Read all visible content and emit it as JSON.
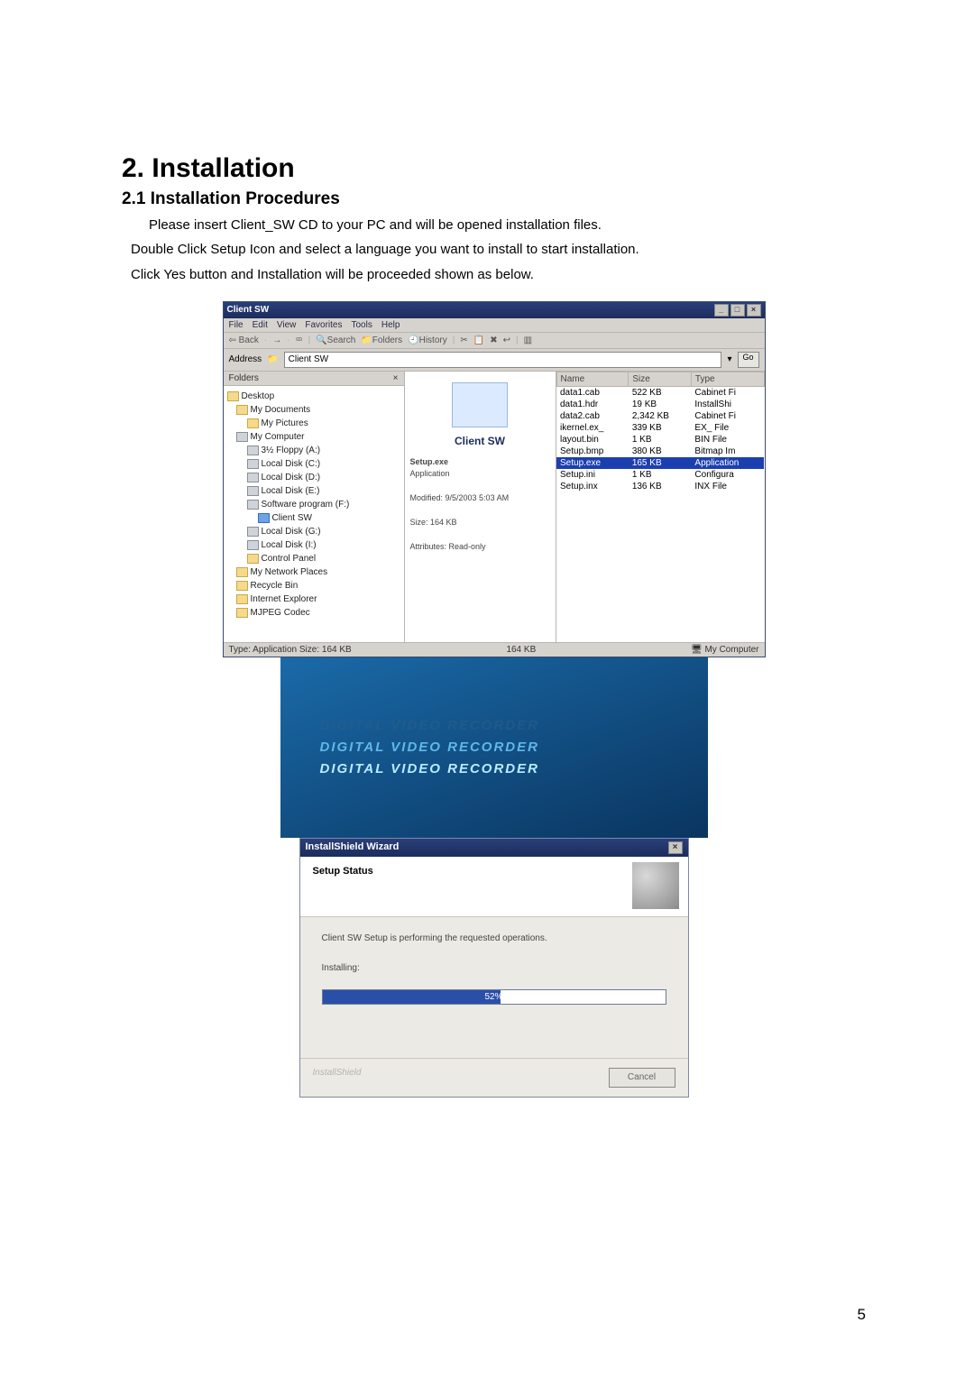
{
  "doc": {
    "h1": "2. Installation",
    "h2": "2.1 Installation Procedures",
    "p1": "Please insert Client_SW CD to your PC and will be opened installation files.",
    "p2": "Double Click Setup Icon and select a language you want to install to start installation.",
    "p3": "Click Yes button and Installation will be proceeded shown as below.",
    "page_number": "5"
  },
  "explorer": {
    "title": "Client SW",
    "menu": [
      "File",
      "Edit",
      "View",
      "Favorites",
      "Tools",
      "Help"
    ],
    "toolbar": {
      "back": "Back",
      "search": "Search",
      "folders": "Folders",
      "history": "History"
    },
    "address_label": "Address",
    "address_value": "Client SW",
    "go": "Go",
    "folders_label": "Folders",
    "close_x": "×",
    "tree": [
      {
        "lvl": 0,
        "label": "Desktop",
        "ic": "ic"
      },
      {
        "lvl": 1,
        "label": "My Documents",
        "ic": "ic"
      },
      {
        "lvl": 2,
        "label": "My Pictures",
        "ic": "ic"
      },
      {
        "lvl": 1,
        "label": "My Computer",
        "ic": "ic disk"
      },
      {
        "lvl": 2,
        "label": "3½ Floppy (A:)",
        "ic": "ic disk"
      },
      {
        "lvl": 2,
        "label": "Local Disk (C:)",
        "ic": "ic disk"
      },
      {
        "lvl": 2,
        "label": "Local Disk (D:)",
        "ic": "ic disk"
      },
      {
        "lvl": 2,
        "label": "Local Disk (E:)",
        "ic": "ic disk"
      },
      {
        "lvl": 2,
        "label": "Software program (F:)",
        "ic": "ic disk"
      },
      {
        "lvl": 3,
        "label": "Client SW",
        "ic": "ic sel"
      },
      {
        "lvl": 2,
        "label": "Local Disk (G:)",
        "ic": "ic disk"
      },
      {
        "lvl": 2,
        "label": "Local Disk (I:)",
        "ic": "ic disk"
      },
      {
        "lvl": 2,
        "label": "Control Panel",
        "ic": "ic"
      },
      {
        "lvl": 1,
        "label": "My Network Places",
        "ic": "ic"
      },
      {
        "lvl": 1,
        "label": "Recycle Bin",
        "ic": "ic"
      },
      {
        "lvl": 1,
        "label": "Internet Explorer",
        "ic": "ic"
      },
      {
        "lvl": 1,
        "label": "MJPEG Codec",
        "ic": "ic"
      }
    ],
    "preview": {
      "title": "Client SW",
      "line1": "Setup.exe",
      "line2": "Application",
      "line3": "Modified: 9/5/2003 5:03 AM",
      "line4": "Size: 164 KB",
      "line5": "Attributes: Read-only"
    },
    "columns": [
      "Name",
      "Size",
      "Type"
    ],
    "files": [
      {
        "name": "data1.cab",
        "size": "522 KB",
        "type": "Cabinet Fi",
        "sel": false
      },
      {
        "name": "data1.hdr",
        "size": "19 KB",
        "type": "InstallShi",
        "sel": false
      },
      {
        "name": "data2.cab",
        "size": "2,342 KB",
        "type": "Cabinet Fi",
        "sel": false
      },
      {
        "name": "ikernel.ex_",
        "size": "339 KB",
        "type": "EX_ File",
        "sel": false
      },
      {
        "name": "layout.bin",
        "size": "1 KB",
        "type": "BIN File",
        "sel": false
      },
      {
        "name": "Setup.bmp",
        "size": "380 KB",
        "type": "Bitmap Im",
        "sel": false
      },
      {
        "name": "Setup.exe",
        "size": "165 KB",
        "type": "Application",
        "sel": true
      },
      {
        "name": "Setup.ini",
        "size": "1 KB",
        "type": "Configura",
        "sel": false
      },
      {
        "name": "Setup.inx",
        "size": "136 KB",
        "type": "INX File",
        "sel": false
      }
    ],
    "status_left": "Type: Application Size: 164 KB",
    "status_mid": "164 KB",
    "status_right": "My Computer"
  },
  "splash": {
    "l1": "DIGITAL VIDEO RECORDER",
    "l2": "DIGITAL VIDEO RECORDER",
    "l3": "DIGITAL VIDEO RECORDER"
  },
  "wizard": {
    "title": "InstallShield Wizard",
    "header": "Setup Status",
    "msg": "Client SW Setup is performing the requested operations.",
    "label": "Installing:",
    "percent": 52,
    "percent_label": "52%",
    "brand": "InstallShield",
    "cancel": "Cancel"
  }
}
